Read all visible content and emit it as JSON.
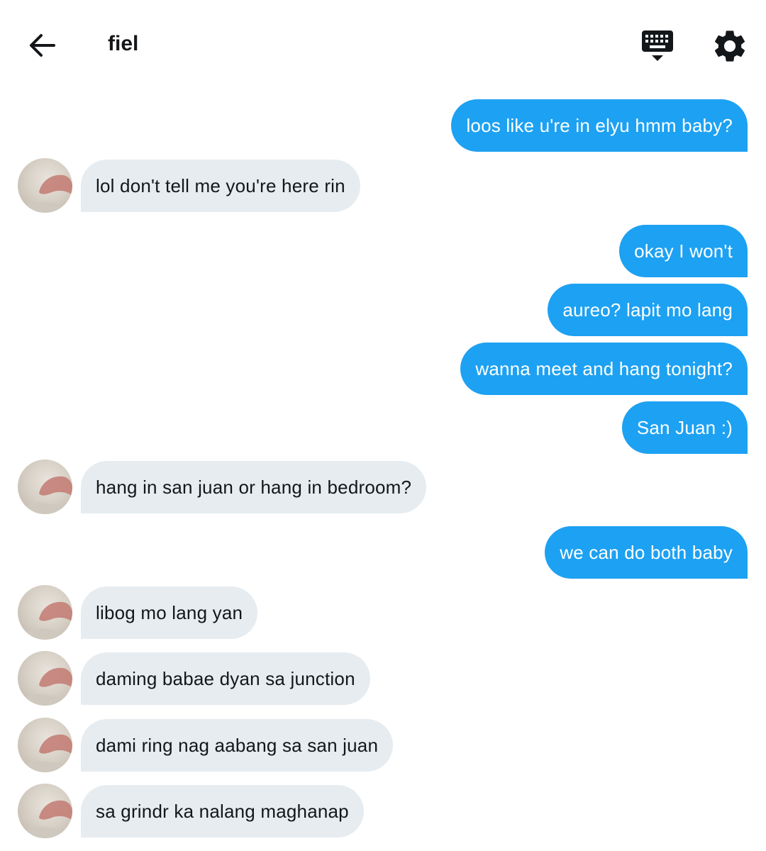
{
  "header": {
    "title": "fiel",
    "back_icon": "arrow-left-icon",
    "keyboard_icon": "keyboard-icon",
    "settings_icon": "gear-icon"
  },
  "colors": {
    "outgoing_bubble": "#1da1f2",
    "incoming_bubble": "#e6ecf0",
    "outgoing_text": "#ffffff",
    "incoming_text": "#14171a"
  },
  "messages": [
    {
      "direction": "out",
      "text": "loos like u're in elyu hmm baby?"
    },
    {
      "direction": "in",
      "text": "lol don't tell me you're here rin"
    },
    {
      "direction": "out",
      "text": "okay I won't"
    },
    {
      "direction": "out",
      "text": "aureo? lapit mo lang"
    },
    {
      "direction": "out",
      "text": "wanna meet and hang tonight?"
    },
    {
      "direction": "out",
      "text": "San Juan :)"
    },
    {
      "direction": "in",
      "text": "hang in san juan or hang in bedroom?"
    },
    {
      "direction": "out",
      "text": "we can do both baby"
    },
    {
      "direction": "in",
      "text": "libog mo lang yan"
    },
    {
      "direction": "in",
      "text": "daming babae dyan sa junction"
    },
    {
      "direction": "in",
      "text": "dami ring nag aabang sa san juan"
    },
    {
      "direction": "in",
      "text": "sa grindr ka nalang maghanap"
    }
  ]
}
